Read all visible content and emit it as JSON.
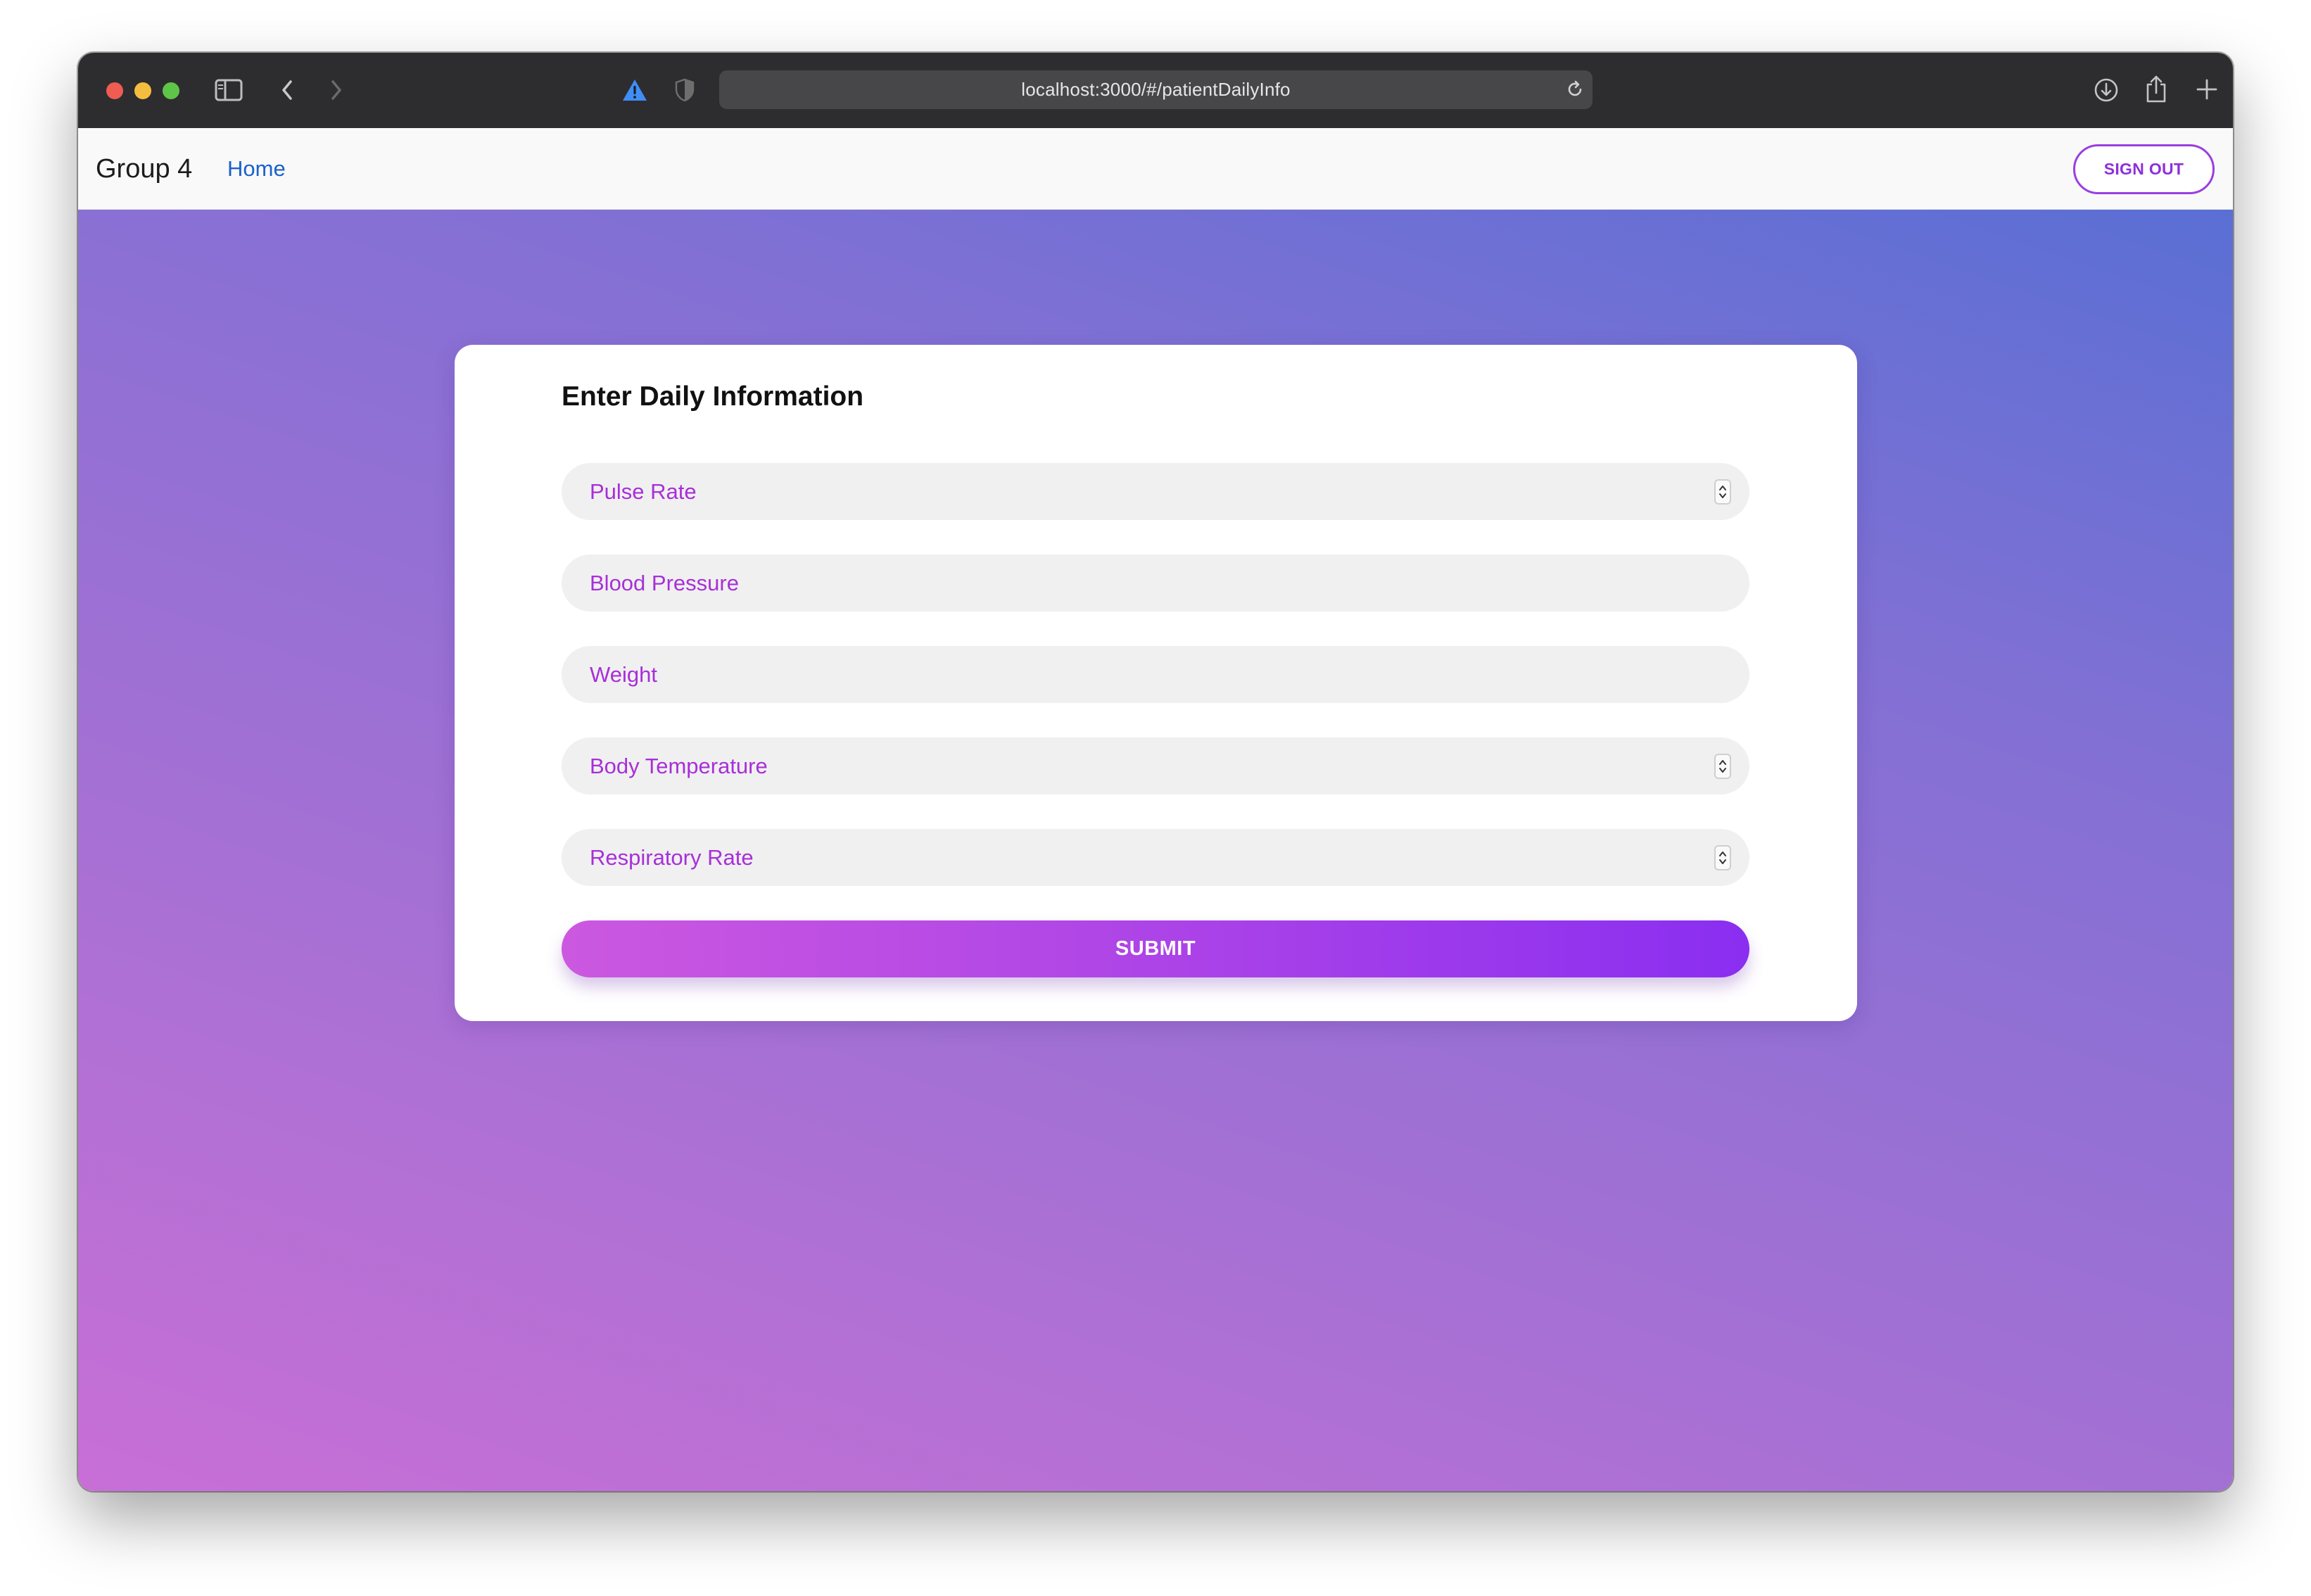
{
  "browser": {
    "url": "localhost:3000/#/patientDailyInfo"
  },
  "navbar": {
    "brand": "Group 4",
    "home_link": "Home",
    "signout_label": "SIGN OUT"
  },
  "form": {
    "title": "Enter Daily Information",
    "fields": [
      {
        "placeholder": "Pulse Rate",
        "type": "number"
      },
      {
        "placeholder": "Blood Pressure",
        "type": "text"
      },
      {
        "placeholder": "Weight",
        "type": "text"
      },
      {
        "placeholder": "Body Temperature",
        "type": "number"
      },
      {
        "placeholder": "Respiratory Rate",
        "type": "number"
      }
    ],
    "submit_label": "SUBMIT"
  },
  "colors": {
    "accent": "#a82fd9",
    "link": "#1a62c9",
    "gradient_start": "#c86fd6",
    "gradient_end": "#5a6fd4"
  },
  "icons": {
    "sidebar": "sidebar-icon",
    "back": "chevron-left-icon",
    "forward": "chevron-right-icon",
    "warning": "warning-icon",
    "privacy": "shield-icon",
    "reload": "reload-icon",
    "download": "download-icon",
    "share": "share-icon",
    "new_tab": "plus-icon",
    "tabs": "tabs-overview-icon"
  }
}
